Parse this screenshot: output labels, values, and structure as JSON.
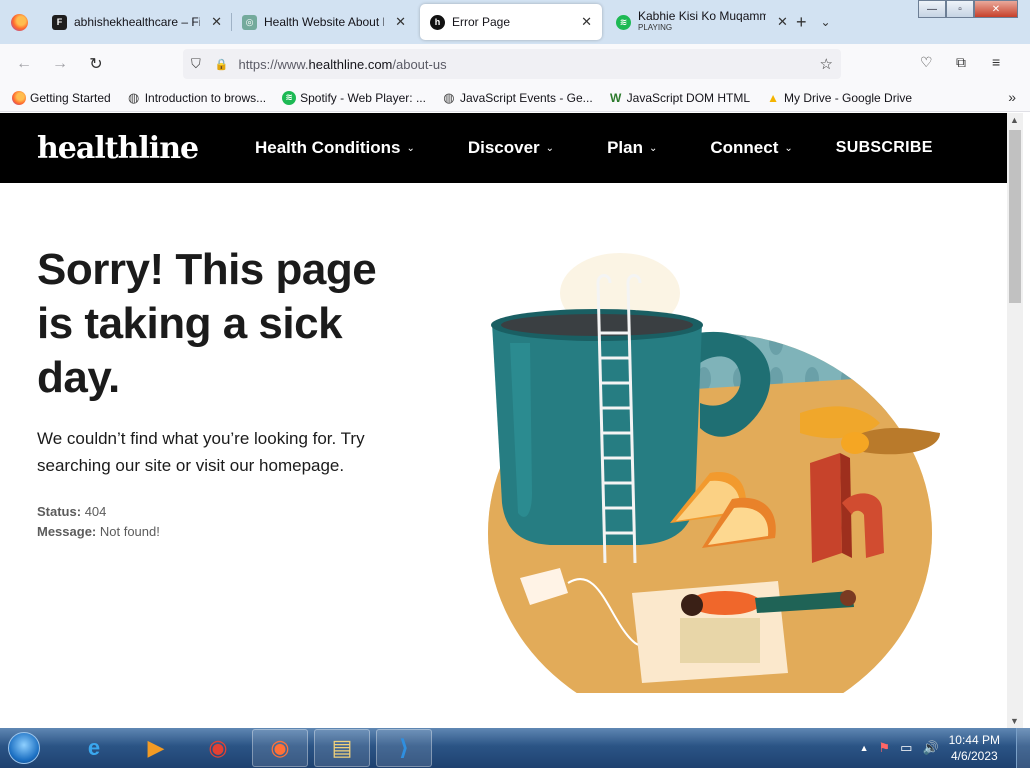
{
  "tabs": [
    {
      "label": "abhishekhealthcare – Fig",
      "close": "✕",
      "color": "#1e1e1e",
      "glyph": "F"
    },
    {
      "label": "Health Website About Pa",
      "close": "✕",
      "color": "#74aa9c",
      "glyph": "◎"
    },
    {
      "label": "Error Page",
      "close": "✕",
      "color": "#111111",
      "glyph": "h"
    },
    {
      "label": "Kabhie Kisi Ko Muqamm",
      "sublabel": "PLAYING",
      "close": "✕",
      "color": "#1db954",
      "glyph": "≋"
    }
  ],
  "new_tab": "+",
  "tab_list": "⌄",
  "window_controls": {
    "minimize": "—",
    "maximize": "▫",
    "close": "✕"
  },
  "nav": {
    "back": "←",
    "forward": "→",
    "reload": "↻"
  },
  "address": {
    "shield": "⛉",
    "lock": "🔒",
    "prefix": "https://www.",
    "domain": "healthline.com",
    "path": "/about-us",
    "star": "☆"
  },
  "toolbar_icons": {
    "pocket": "♡",
    "extensions": "⧉",
    "menu": "≡"
  },
  "bookmarks": [
    {
      "label": "Getting Started",
      "icon": "firefox-icon",
      "color": "#ff6a2c",
      "glyph": ""
    },
    {
      "label": "Introduction to brows...",
      "icon": "globe-icon",
      "color": "#555555",
      "glyph": "◍"
    },
    {
      "label": "Spotify - Web Player: ...",
      "icon": "spotify-icon",
      "color": "#1db954",
      "glyph": "≋"
    },
    {
      "label": "JavaScript Events - Ge...",
      "icon": "globe-icon",
      "color": "#555555",
      "glyph": "◍"
    },
    {
      "label": "JavaScript DOM HTML",
      "icon": "w3-icon",
      "color": "#2c7a2c",
      "glyph": "W"
    },
    {
      "label": "My Drive - Google Drive",
      "icon": "google-drive-icon",
      "color": "#f4b400",
      "glyph": "▲"
    }
  ],
  "bookmarks_more": "»",
  "site": {
    "logo": "healthline",
    "menu": [
      {
        "label": "Health Conditions",
        "chevron": "⌄"
      },
      {
        "label": "Discover",
        "chevron": "⌄"
      },
      {
        "label": "Plan",
        "chevron": "⌄"
      },
      {
        "label": "Connect",
        "chevron": "⌄"
      }
    ],
    "subscribe": "SUBSCRIBE"
  },
  "error": {
    "headline": "Sorry! This page is taking a sick day.",
    "message": "We couldn’t find what you’re looking for. Try searching our site or visit our homepage.",
    "status_label": "Status:",
    "status_value": "404",
    "message_label": "Message:",
    "message_value": "Not found!"
  },
  "scrollbar": {
    "up": "▲",
    "down": "▼"
  },
  "taskbar": {
    "apps": [
      {
        "name": "internet-explorer-icon",
        "glyph": "e",
        "color": "#3aa7ee"
      },
      {
        "name": "media-player-icon",
        "glyph": "▶",
        "color": "#f39b24"
      },
      {
        "name": "chrome-icon",
        "glyph": "◉",
        "color": "#e34133"
      },
      {
        "name": "firefox-icon",
        "glyph": "◉",
        "color": "#ff7139"
      },
      {
        "name": "file-explorer-icon",
        "glyph": "▤",
        "color": "#f2d27a"
      },
      {
        "name": "vscode-icon",
        "glyph": "⟩",
        "color": "#2f8fe0"
      }
    ],
    "tray_arrow": "▲",
    "time": "10:44 PM",
    "date": "4/6/2023"
  }
}
